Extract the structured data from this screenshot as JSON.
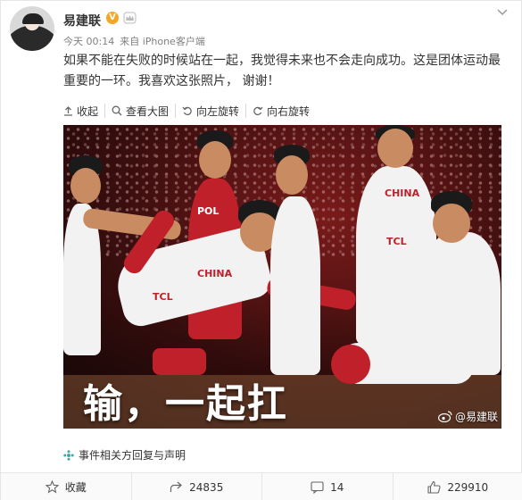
{
  "post": {
    "username": "易建联",
    "verified_badge": "V",
    "time": "今天 00:14",
    "source": "来自 iPhone客户端",
    "text": "如果不能在失败的时候站在一起，我觉得未来也不会走向成功。这是团体运动最重要的一环。我喜欢这张照片， 谢谢！"
  },
  "toolbar": {
    "collapse_label": "收起",
    "view_large_label": "查看大图",
    "rotate_left_label": "向左旋转",
    "rotate_right_label": "向右旋转"
  },
  "photo": {
    "overlay_text": "输，一起扛",
    "watermark": "@易建联",
    "jersey_texts": [
      "CHINA",
      "POL",
      "TCL"
    ]
  },
  "event_link": "事件相关方回复与声明",
  "footer": {
    "favorite_label": "收藏",
    "repost_count": "24835",
    "comment_count": "14",
    "like_count": "229910"
  },
  "colors": {
    "accent_orange": "#f5a623",
    "link_text": "#333333",
    "event_icon": "#3fa9a0"
  }
}
